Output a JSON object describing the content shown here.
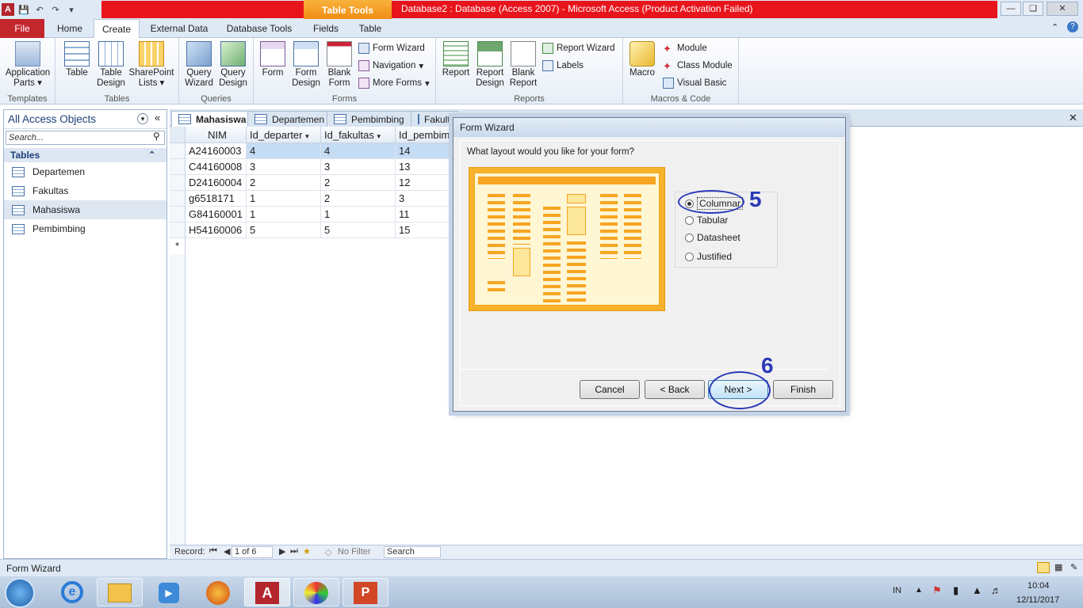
{
  "window": {
    "title": "Database2 : Database (Access 2007)  -  Microsoft Access (Product Activation Failed)",
    "context_tab": "Table Tools"
  },
  "ribbon": {
    "tabs": [
      "File",
      "Home",
      "Create",
      "External Data",
      "Database Tools",
      "Fields",
      "Table"
    ],
    "active_tab": "Create",
    "groups": {
      "templates": {
        "label": "Templates",
        "app_parts": "Application Parts"
      },
      "tables": {
        "label": "Tables",
        "table": "Table",
        "table_design": "Table Design",
        "sharepoint": "SharePoint Lists"
      },
      "queries": {
        "label": "Queries",
        "query_wizard": "Query Wizard",
        "query_design": "Query Design"
      },
      "forms": {
        "label": "Forms",
        "form": "Form",
        "form_design": "Form Design",
        "blank_form": "Blank Form",
        "form_wizard": "Form Wizard",
        "navigation": "Navigation",
        "more_forms": "More Forms"
      },
      "reports": {
        "label": "Reports",
        "report": "Report",
        "report_design": "Report Design",
        "blank_report": "Blank Report",
        "report_wizard": "Report Wizard",
        "labels": "Labels"
      },
      "macros": {
        "label": "Macros & Code",
        "macro": "Macro",
        "module": "Module",
        "class_module": "Class Module",
        "visual_basic": "Visual Basic"
      }
    }
  },
  "nav": {
    "header": "All Access Objects",
    "search_placeholder": "Search...",
    "section": "Tables",
    "items": [
      "Departemen",
      "Fakultas",
      "Mahasiswa",
      "Pembimbing"
    ],
    "selected": "Mahasiswa"
  },
  "doc_tabs": [
    "Mahasiswa",
    "Departemen",
    "Pembimbing",
    "Fakultas"
  ],
  "grid": {
    "columns": [
      "NIM",
      "Id_departer",
      "Id_fakultas",
      "Id_pembim"
    ],
    "rows": [
      [
        "A24160003",
        "4",
        "4",
        "14"
      ],
      [
        "C44160008",
        "3",
        "3",
        "13"
      ],
      [
        "D24160004",
        "2",
        "2",
        "12"
      ],
      [
        "g6518171",
        "1",
        "2",
        "3"
      ],
      [
        "G84160001",
        "1",
        "1",
        "11"
      ],
      [
        "H54160006",
        "5",
        "5",
        "15"
      ]
    ],
    "new_row_marker": "*"
  },
  "record_bar": {
    "label": "Record:",
    "position": "1 of 6",
    "filter": "No Filter",
    "search": "Search"
  },
  "status": {
    "text": "Form Wizard"
  },
  "dialog": {
    "title": "Form Wizard",
    "question": "What layout would you like for your form?",
    "options": [
      "Columnar",
      "Tabular",
      "Datasheet",
      "Justified"
    ],
    "selected": "Columnar",
    "buttons": {
      "cancel": "Cancel",
      "back": "< Back",
      "next": "Next >",
      "finish": "Finish"
    },
    "annotations": {
      "step5": "5",
      "step6": "6"
    },
    "annotation_color": "#2b3ab8"
  },
  "taskbar": {
    "lang": "IN",
    "time": "10:04",
    "date": "12/11/2017"
  }
}
